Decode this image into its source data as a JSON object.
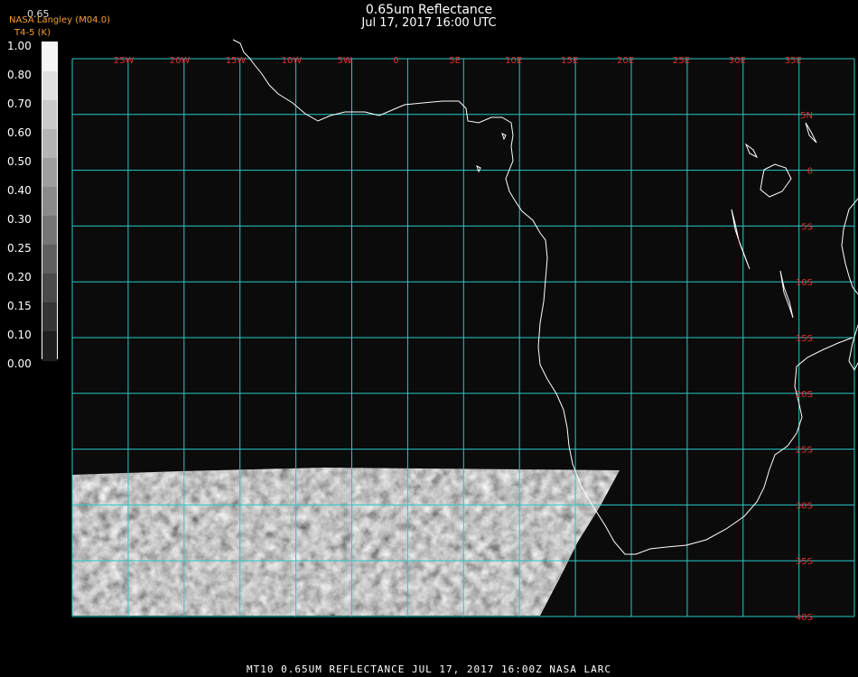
{
  "header": {
    "title": "0.65um Reflectance",
    "datetime": "Jul 17, 2017 16:00 UTC",
    "credit": "NASA Langley (M04.0)",
    "credit_line2": "T4-5 (K)",
    "ghost_label": "0.65"
  },
  "legend": {
    "labels": [
      "1.00",
      "0.80",
      "0.70",
      "0.60",
      "0.50",
      "0.40",
      "0.30",
      "0.25",
      "0.20",
      "0.15",
      "0.10",
      "0.00"
    ]
  },
  "grid": {
    "lon_labels": [
      "25W",
      "20W",
      "15W",
      "10W",
      "5W",
      "0",
      "5E",
      "10E",
      "15E",
      "20E",
      "25E",
      "30E",
      "35E"
    ],
    "lat_labels": [
      "5N",
      "0",
      "5S",
      "10S",
      "15S",
      "20S",
      "25S",
      "30S",
      "35S",
      "40S"
    ],
    "grid_color": "#28c8c8",
    "label_color": "#e03030"
  },
  "footer": {
    "text": "MT10  0.65UM REFLECTANCE   JUL 17, 2017 16:00Z   NASA LARC"
  }
}
